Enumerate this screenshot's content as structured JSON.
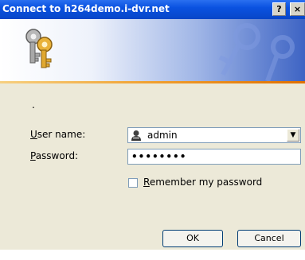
{
  "window": {
    "title": "Connect to h264demo.i-dvr.net",
    "help_label": "?",
    "close_label": "×"
  },
  "banner": {
    "icon": "keys-icon",
    "decoration": "keys-decoration"
  },
  "form": {
    "dot": ".",
    "username": {
      "label_accel": "U",
      "label_rest": "ser name:",
      "value": "admin",
      "icon": "user-icon"
    },
    "password": {
      "label_accel": "P",
      "label_rest": "assword:",
      "value": "••••••••"
    },
    "remember": {
      "label_accel": "R",
      "label_rest": "emember my password",
      "checked": false
    }
  },
  "buttons": {
    "ok_label": "OK",
    "cancel_label": "Cancel"
  },
  "colors": {
    "titlebar": "#0a52e0",
    "face": "#ece9d8",
    "accent_line": "#f0a030"
  }
}
